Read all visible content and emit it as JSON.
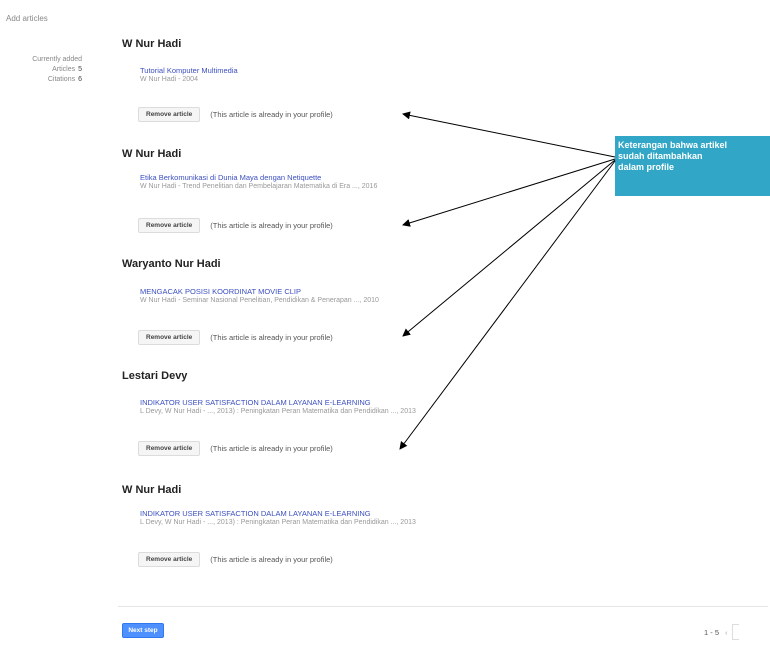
{
  "page": {
    "title": "Add articles"
  },
  "stats": {
    "heading": "Currently added",
    "articles_label": "Articles",
    "articles_value": "5",
    "citations_label": "Citations",
    "citations_value": "6"
  },
  "groups": [
    {
      "author": "W Nur Hadi",
      "title": "Tutorial Komputer Multimedia",
      "meta": "W Nur Hadi - 2004",
      "remove_label": "Remove article",
      "note": "(This article is already in your profile)"
    },
    {
      "author": "W Nur Hadi",
      "title": "Etika Berkomunikasi di Dunia Maya dengan Netiquette",
      "meta": "W Nur Hadi - Trend Penelitian dan Pembelajaran Matematika di Era ..., 2016",
      "remove_label": "Remove article",
      "note": "(This article is already in your profile)"
    },
    {
      "author": "Waryanto Nur Hadi",
      "title": "MENGACAK POSISI KOORDINAT MOVIE CLIP",
      "meta": "W Nur Hadi - Seminar Nasional Penelitian, Pendidikan & Penerapan ..., 2010",
      "remove_label": "Remove article",
      "note": "(This article is already in your profile)"
    },
    {
      "author": "Lestari Devy",
      "title": "INDIKATOR USER SATISFACTION DALAM LAYANAN E-LEARNING",
      "meta": "L Devy, W Nur Hadi - ..., 2013) : Peningkatan Peran Matematika dan Pendidikan ..., 2013",
      "remove_label": "Remove article",
      "note": "(This article is already in your profile)"
    },
    {
      "author": "W Nur Hadi",
      "title": "INDIKATOR USER SATISFACTION DALAM LAYANAN E-LEARNING",
      "meta": "L Devy, W Nur Hadi - ..., 2013) : Peningkatan Peran Matematika dan Pendidikan ..., 2013",
      "remove_label": "Remove article",
      "note": "(This article is already in your profile)"
    }
  ],
  "footer": {
    "next_step": "Next step",
    "range": "1 - 5",
    "prev_icon": "chevron-left-icon"
  },
  "callout": {
    "text": "Keterangan bahwa artikel\nsudah ditambahkan\ndalam profile",
    "color": "#31a6c6"
  }
}
